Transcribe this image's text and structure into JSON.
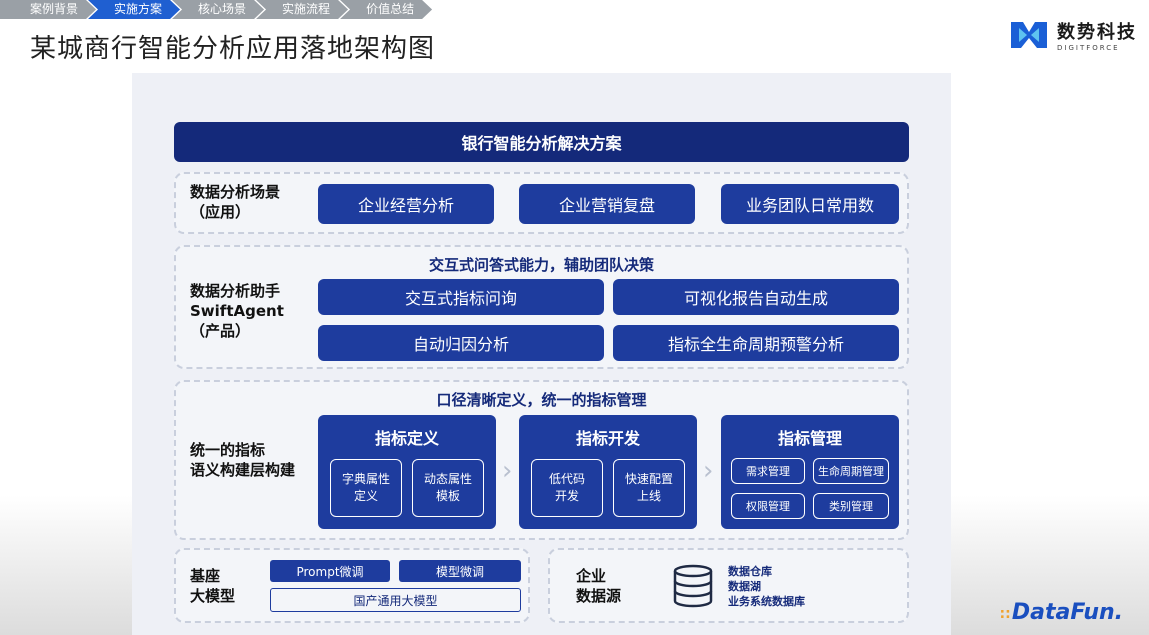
{
  "breadcrumb": [
    "案例背景",
    "实施方案",
    "核心场景",
    "实施流程",
    "价值总结"
  ],
  "breadcrumb_active_index": 1,
  "page_title": "某城商行智能分析应用落地架构图",
  "logo": {
    "cn": "数势科技",
    "en": "DIGITFORCE"
  },
  "banner": "银行智能分析解决方案",
  "scenes": {
    "label": "数据分析场景\n（应用）",
    "items": [
      "企业经营分析",
      "企业营销复盘",
      "业务团队日常用数"
    ]
  },
  "assistant": {
    "label": "数据分析助手\nSwiftAgent\n（产品）",
    "caption": "交互式问答式能力，辅助团队决策",
    "items": [
      "交互式指标问询",
      "可视化报告自动生成",
      "自动归因分析",
      "指标全生命周期预警分析"
    ]
  },
  "semantic": {
    "label": "统一的指标\n语义构建层构建",
    "caption": "口径清晰定义，统一的指标管理",
    "cards": [
      {
        "title": "指标定义",
        "subs": [
          "字典属性\n定义",
          "动态属性\n模板"
        ]
      },
      {
        "title": "指标开发",
        "subs": [
          "低代码\n开发",
          "快速配置\n上线"
        ]
      },
      {
        "title": "指标管理",
        "subs": [
          "需求管理",
          "生命周期管理",
          "权限管理",
          "类别管理"
        ]
      }
    ]
  },
  "base": {
    "label": "基座\n大模型",
    "pills": [
      "Prompt微调",
      "模型微调"
    ],
    "outline": "国产通用大模型"
  },
  "datasource": {
    "label": "企业\n数据源",
    "items": [
      "数据仓库",
      "数据湖",
      "业务系统数据库"
    ]
  },
  "footer_logo": "DataFun.",
  "colors": {
    "dark_navy": "#14297a",
    "block_blue": "#1e3c9e",
    "breadcrumb_active": "#1f5fd1",
    "breadcrumb_inactive": "#9aa0a6",
    "accent_orange": "#f0a22e"
  }
}
